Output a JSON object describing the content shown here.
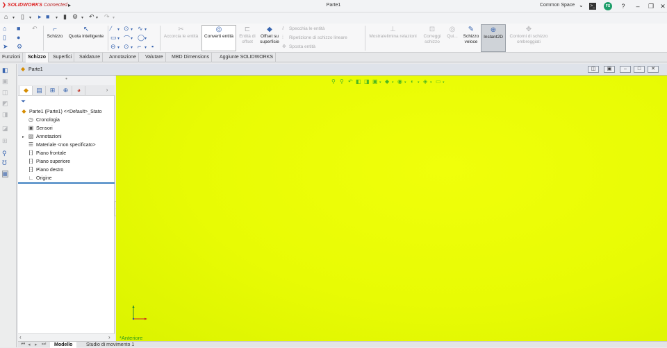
{
  "app": {
    "brand_bold": "SOLIDWORKS",
    "brand_suffix": "Connected",
    "menu_arrow": "▸",
    "document_title": "Parte1",
    "workspace": "Common Space",
    "user_initials": "FS"
  },
  "titlebar_icons": [
    "terminal-icon",
    "user-avatar",
    "help-icon",
    "restore-icon",
    "close-icon"
  ],
  "ribbon": {
    "schizzo": "Schizzo",
    "quota": "Quota intelligente",
    "accorcia": "Accorcia le entità",
    "converti": "Converti entità",
    "entita_offset": "Entità di offset",
    "offset_superficie": "Offset su superficie",
    "specchia": "Specchia le entità",
    "ripetizione": "Ripetizione di schizzo lineare",
    "sposta": "Sposta entità",
    "mostra_relazioni": "Mostra/elimina relazioni",
    "correggi": "Correggi schizzo",
    "qui": "Qui...",
    "schizzo_veloce": "Schizzo veloce",
    "instant2d": "Instant2D",
    "contorni": "Contorni di schizzo ombreggiati"
  },
  "tabs": [
    "Funzioni",
    "Schizzo",
    "Superfici",
    "Saldature",
    "Annotazione",
    "Valutare",
    "MBD Dimensions",
    "Aggiunte SOLIDWORKS"
  ],
  "active_tab": "Schizzo",
  "document": {
    "tab_name": "Parte1"
  },
  "feature_tree": {
    "root": "Parte1  (Parte1) <<Default>_Stato",
    "items": [
      {
        "icon": "history-icon",
        "label": "Cronologia"
      },
      {
        "icon": "sensor-icon",
        "label": "Sensori"
      },
      {
        "icon": "annotations-icon",
        "label": "Annotazioni"
      },
      {
        "icon": "material-icon",
        "label": "Materiale <non specificato>"
      },
      {
        "icon": "plane-icon",
        "label": "Piano frontale"
      },
      {
        "icon": "plane-icon",
        "label": "Piano superiore"
      },
      {
        "icon": "plane-icon",
        "label": "Piano destro"
      },
      {
        "icon": "origin-icon",
        "label": "Origine"
      }
    ]
  },
  "viewport": {
    "background_color": "#e8fb04",
    "view_orientation": "*Anteriore"
  },
  "bottom_tabs": [
    "Modello",
    "Studio di movimento 1"
  ],
  "active_bottom_tab": "Modello",
  "colors": {
    "accent_blue": "#3a66b0",
    "brand_red": "#d22222",
    "hud_green": "#4db820",
    "tree_separator": "#3d7fc0"
  }
}
